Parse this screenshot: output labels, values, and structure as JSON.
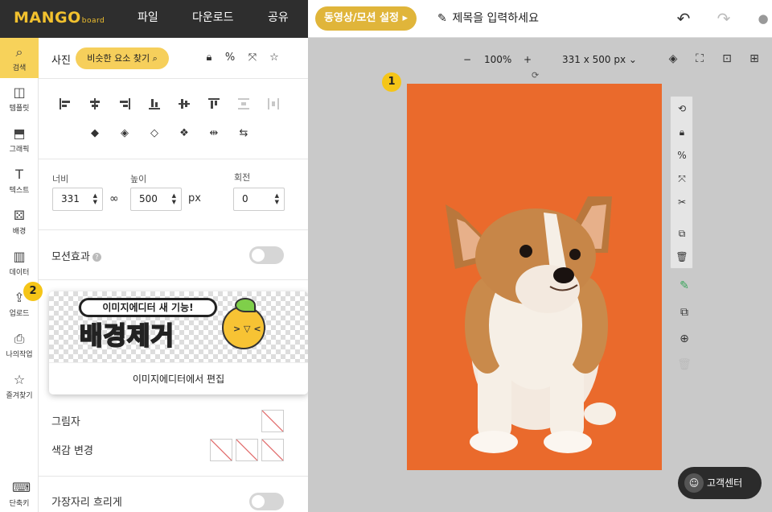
{
  "app": {
    "logo": "MANGO",
    "logo_sub": "board",
    "menu": [
      "파일",
      "다운로드",
      "공유"
    ],
    "motion_button": "동영상/모션 설정 ▸",
    "title_placeholder": "제목을 입력하세요"
  },
  "leftnav": [
    {
      "label": "검색",
      "icon": "search-icon"
    },
    {
      "label": "템플릿",
      "icon": "template-icon"
    },
    {
      "label": "그래픽",
      "icon": "graphic-icon"
    },
    {
      "label": "텍스트",
      "icon": "text-icon"
    },
    {
      "label": "배경",
      "icon": "background-icon"
    },
    {
      "label": "데이터",
      "icon": "chart-icon"
    },
    {
      "label": "업로드",
      "icon": "upload-icon"
    },
    {
      "label": "나의작업",
      "icon": "mywork-icon"
    },
    {
      "label": "즐겨찾기",
      "icon": "star-icon"
    },
    {
      "label": "단축키",
      "icon": "keyboard-icon"
    }
  ],
  "panel": {
    "title": "사진",
    "similar_button": "비슷한 요소 찾기",
    "width_label": "너비",
    "height_label": "높이",
    "rotate_label": "회전",
    "width": "331",
    "height": "500",
    "rotate": "0",
    "unit": "px",
    "motion_label": "모션효과",
    "shadow_label": "그림자",
    "color_label": "색감 변경",
    "blur_label": "가장자리 흐리게"
  },
  "promo": {
    "bubble": "이미지에디터 새 기능!",
    "headline": "배경제거",
    "caption": "이미지에디터에서 편집"
  },
  "canvas": {
    "zoom": "100%",
    "size": "331 x 500 px",
    "badge1": "1",
    "badge2": "2",
    "photo_bg": "#ea6a2c"
  },
  "support": "고객센터",
  "colors": {
    "accent": "#f6cf5b",
    "topbar_dark": "#2e2e2e",
    "canvas_bg": "#c9c9c9"
  }
}
